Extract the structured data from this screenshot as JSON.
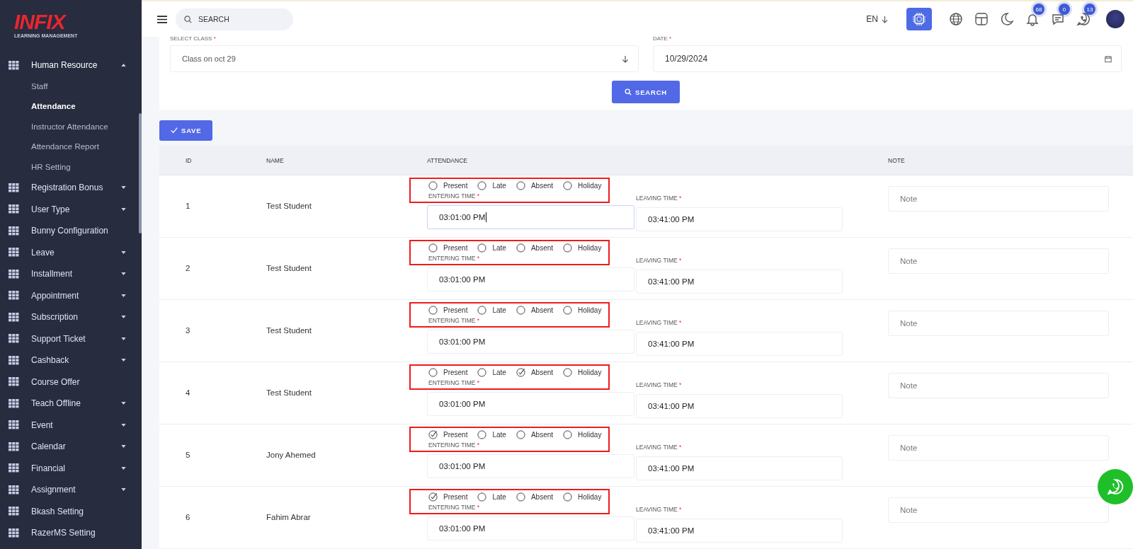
{
  "sidebar": {
    "logo": {
      "title": "INFIX",
      "subtitle": "LEARNING MANAGEMENT"
    },
    "items": [
      {
        "label": "Human Resource",
        "kind": "group",
        "expanded": true,
        "children": [
          {
            "label": "Staff",
            "selected": false
          },
          {
            "label": "Attendance",
            "selected": true
          },
          {
            "label": "Instructor Attendance",
            "selected": false
          },
          {
            "label": "Attendance Report",
            "selected": false
          },
          {
            "label": "HR Setting",
            "selected": false
          }
        ]
      },
      {
        "label": "Registration Bonus",
        "kind": "group",
        "expanded": false
      },
      {
        "label": "User Type",
        "kind": "group",
        "expanded": false
      },
      {
        "label": "Bunny Configuration",
        "kind": "link"
      },
      {
        "label": "Leave",
        "kind": "group",
        "expanded": false
      },
      {
        "label": "Installment",
        "kind": "group",
        "expanded": false
      },
      {
        "label": "Appointment",
        "kind": "group",
        "expanded": false
      },
      {
        "label": "Subscription",
        "kind": "group",
        "expanded": false
      },
      {
        "label": "Support Ticket",
        "kind": "group",
        "expanded": false
      },
      {
        "label": "Cashback",
        "kind": "group",
        "expanded": false
      },
      {
        "label": "Course Offer",
        "kind": "link"
      },
      {
        "label": "Teach Offline",
        "kind": "group",
        "expanded": false
      },
      {
        "label": "Event",
        "kind": "group",
        "expanded": false
      },
      {
        "label": "Calendar",
        "kind": "group",
        "expanded": false
      },
      {
        "label": "Financial",
        "kind": "group",
        "expanded": false
      },
      {
        "label": "Assignment",
        "kind": "group",
        "expanded": false
      },
      {
        "label": "Bkash Setting",
        "kind": "link"
      },
      {
        "label": "RazerMS Setting",
        "kind": "link"
      }
    ]
  },
  "header": {
    "search": {
      "placeholder": "SEARCH"
    },
    "language": "EN",
    "badges": [
      {
        "kind": "bell",
        "count": "68"
      },
      {
        "kind": "chat",
        "count": "0"
      },
      {
        "kind": "phone",
        "count": "13"
      }
    ]
  },
  "filter": {
    "class_label": "SELECT CLASS",
    "class_mark": "*",
    "class_value": "Class on oct 29",
    "date_label": "DATE",
    "date_mark": "*",
    "date_value": "10/29/2024",
    "search_button": "SEARCH"
  },
  "save_button": "SAVE",
  "table": {
    "columns": [
      "ID",
      "NAME",
      "ATTENDANCE",
      "NOTE"
    ],
    "rows": [
      {
        "id": "1",
        "name": "Test Student",
        "highlighted": true,
        "options": [
          {
            "label": "Present",
            "selected": false
          },
          {
            "label": "Late",
            "selected": false
          },
          {
            "label": "Absent",
            "selected": false
          },
          {
            "label": "Holiday",
            "selected": false
          }
        ],
        "entering": {
          "label": "ENTERING TIME",
          "mark": "*",
          "value": "03:01:00 PM",
          "focused": true
        },
        "leaving": {
          "label": "LEAVING TIME",
          "mark": "*",
          "value": "03:41:00 PM"
        },
        "note": {
          "placeholder": "Note"
        }
      },
      {
        "id": "2",
        "name": "Test Student",
        "highlighted": true,
        "options": [
          {
            "label": "Present",
            "selected": false
          },
          {
            "label": "Late",
            "selected": false
          },
          {
            "label": "Absent",
            "selected": false
          },
          {
            "label": "Holiday",
            "selected": false
          }
        ],
        "entering": {
          "label": "ENTERING TIME",
          "mark": "*",
          "value": "03:01:00 PM",
          "focused": false
        },
        "leaving": {
          "label": "LEAVING TIME",
          "mark": "*",
          "value": "03:41:00 PM"
        },
        "note": {
          "placeholder": "Note"
        }
      },
      {
        "id": "3",
        "name": "Test Student",
        "highlighted": true,
        "options": [
          {
            "label": "Present",
            "selected": false
          },
          {
            "label": "Late",
            "selected": false
          },
          {
            "label": "Absent",
            "selected": false
          },
          {
            "label": "Holiday",
            "selected": false
          }
        ],
        "entering": {
          "label": "ENTERING TIME",
          "mark": "*",
          "value": "03:01:00 PM",
          "focused": false
        },
        "leaving": {
          "label": "LEAVING TIME",
          "mark": "*",
          "value": "03:41:00 PM"
        },
        "note": {
          "placeholder": "Note"
        }
      },
      {
        "id": "4",
        "name": "Test Student",
        "highlighted": true,
        "options": [
          {
            "label": "Present",
            "selected": false
          },
          {
            "label": "Late",
            "selected": false
          },
          {
            "label": "Absent",
            "selected": true
          },
          {
            "label": "Holiday",
            "selected": false
          }
        ],
        "entering": {
          "label": "ENTERING TIME",
          "mark": "*",
          "value": "03:01:00 PM",
          "focused": false
        },
        "leaving": {
          "label": "LEAVING TIME",
          "mark": "*",
          "value": "03:41:00 PM"
        },
        "note": {
          "placeholder": "Note"
        }
      },
      {
        "id": "5",
        "name": "Jony Ahemed",
        "highlighted": true,
        "options": [
          {
            "label": "Present",
            "selected": true
          },
          {
            "label": "Late",
            "selected": false
          },
          {
            "label": "Absent",
            "selected": false
          },
          {
            "label": "Holiday",
            "selected": false
          }
        ],
        "entering": {
          "label": "ENTERING TIME",
          "mark": "*",
          "value": "03:01:00 PM",
          "focused": false
        },
        "leaving": {
          "label": "LEAVING TIME",
          "mark": "*",
          "value": "03:41:00 PM"
        },
        "note": {
          "placeholder": "Note"
        }
      },
      {
        "id": "6",
        "name": "Fahim Abrar",
        "highlighted": true,
        "options": [
          {
            "label": "Present",
            "selected": true
          },
          {
            "label": "Late",
            "selected": false
          },
          {
            "label": "Absent",
            "selected": false
          },
          {
            "label": "Holiday",
            "selected": false
          }
        ],
        "entering": {
          "label": "ENTERING TIME",
          "mark": "*",
          "value": "03:01:00 PM",
          "focused": false
        },
        "leaving": {
          "label": "LEAVING TIME",
          "mark": "*",
          "value": "03:41:00 PM"
        },
        "note": {
          "placeholder": "Note"
        }
      }
    ]
  }
}
